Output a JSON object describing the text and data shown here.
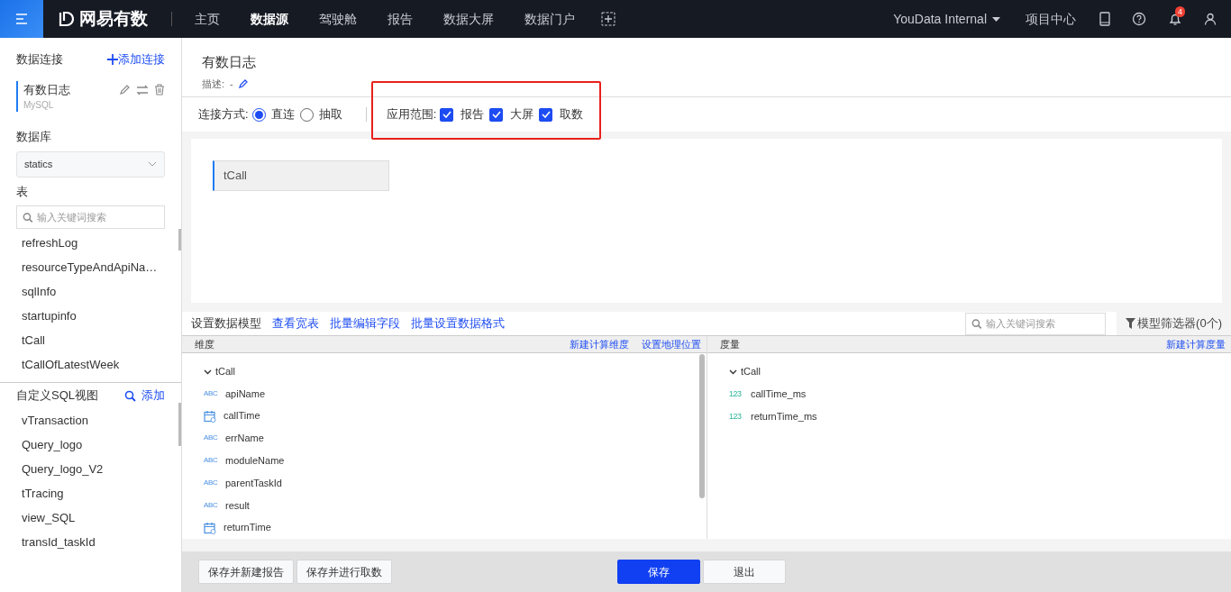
{
  "nav": {
    "brand": "网易有数",
    "items": [
      {
        "label": "主页",
        "selected": false
      },
      {
        "label": "数据源",
        "selected": true
      },
      {
        "label": "驾驶舱",
        "selected": false
      },
      {
        "label": "报告",
        "selected": false
      },
      {
        "label": "数据大屏",
        "selected": false
      },
      {
        "label": "数据门户",
        "selected": false
      }
    ],
    "project": "YouData Internal",
    "project_center": "项目中心",
    "notification_count": "4"
  },
  "sidebar": {
    "title": "数据连接",
    "add_label": "添加连接",
    "connections": [
      {
        "name": "有数日志",
        "type": "MySQL",
        "selected": true
      }
    ],
    "database_label": "数据库",
    "database": "statics",
    "tables_label": "表",
    "search": {
      "placeholder": "输入关键词搜索"
    },
    "tables": [
      "refreshLog",
      "resourceTypeAndApiNa…",
      "sqlInfo",
      "startupinfo",
      "tCall",
      "tCallOfLatestWeek"
    ],
    "sql_views_label": "自定义SQL视图",
    "sql_add_label": "添加",
    "sql_views": [
      "vTransaction",
      "Query_logo",
      "Query_logo_V2",
      "tTracing",
      "view_SQL",
      "transId_taskId"
    ]
  },
  "main": {
    "title": "有数日志",
    "description_label": "描述:",
    "description": "-",
    "connect_label": "连接方式:",
    "connect_options": [
      {
        "label": "直连",
        "selected": true
      },
      {
        "label": "抽取",
        "selected": false
      }
    ],
    "scope_label": "应用范围:",
    "scope_highlighted": true,
    "scope_options": [
      {
        "label": "报告",
        "checked": true
      },
      {
        "label": "大屏",
        "checked": true
      },
      {
        "label": "取数",
        "checked": true
      }
    ],
    "canvas_tables": [
      "tCall"
    ],
    "toolbar": {
      "label": "设置数据模型",
      "links": [
        "查看宽表",
        "批量编辑字段",
        "批量设置数据格式"
      ],
      "search": {
        "placeholder": "输入关键词搜索"
      },
      "filter": "模型筛选器(0个)"
    },
    "dimensions": {
      "header": "维度",
      "actions": [
        "新建计算维度",
        "设置地理位置"
      ],
      "group": "tCall",
      "expanded": true,
      "fields": [
        {
          "name": "apiName",
          "kind": "text",
          "type_tag": "ABC"
        },
        {
          "name": "callTime",
          "kind": "date"
        },
        {
          "name": "errName",
          "kind": "text",
          "type_tag": "ABC"
        },
        {
          "name": "moduleName",
          "kind": "text",
          "type_tag": "ABC"
        },
        {
          "name": "parentTaskId",
          "kind": "text",
          "type_tag": "ABC"
        },
        {
          "name": "result",
          "kind": "text",
          "type_tag": "ABC"
        },
        {
          "name": "returnTime",
          "kind": "date"
        }
      ]
    },
    "measures": {
      "header": "度量",
      "actions": [
        "新建计算度量"
      ],
      "group": "tCall",
      "expanded": true,
      "fields": [
        {
          "name": "callTime_ms",
          "kind": "number",
          "type_tag": "123"
        },
        {
          "name": "returnTime_ms",
          "kind": "number",
          "type_tag": "123"
        }
      ]
    },
    "footer_buttons": [
      {
        "label": "保存并新建报告",
        "kind": "default"
      },
      {
        "label": "保存并进行取数",
        "kind": "default"
      },
      {
        "label": "保存",
        "kind": "primary"
      },
      {
        "label": "退出",
        "kind": "default"
      }
    ]
  }
}
